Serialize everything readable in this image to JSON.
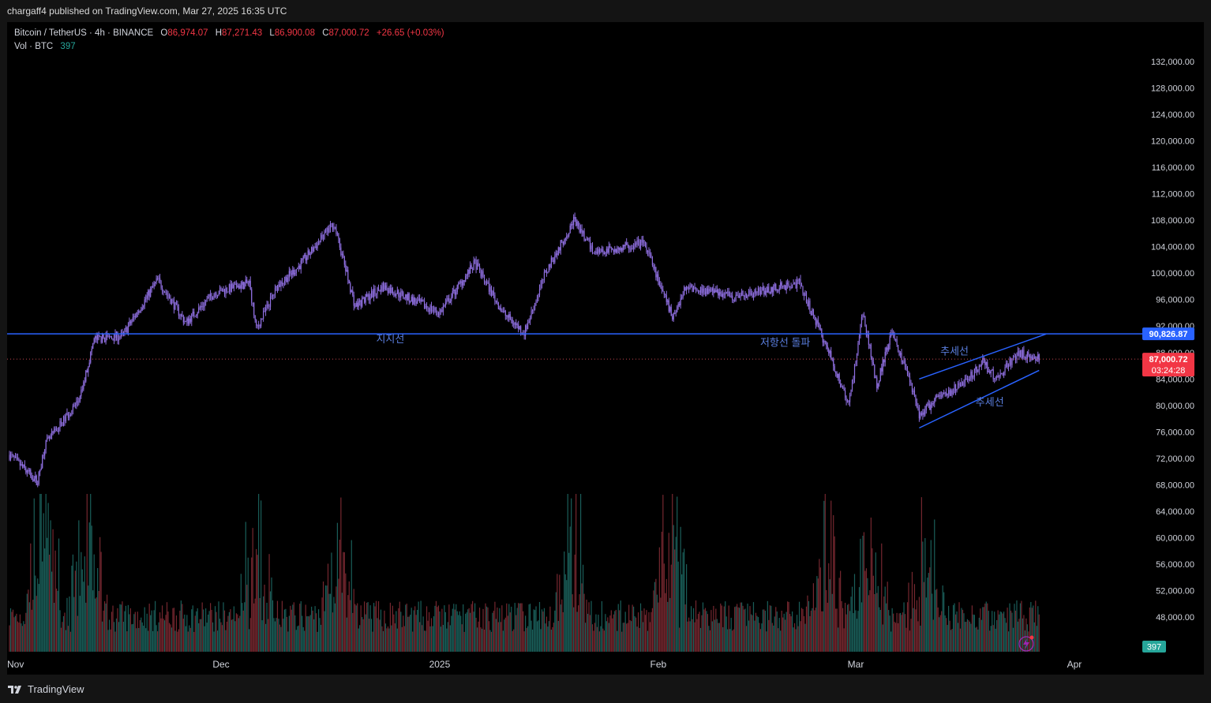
{
  "publish_line": "chargaff4 published on TradingView.com, Mar 27, 2025 16:35 UTC",
  "legend": {
    "symbol": "Bitcoin / TetherUS · 4h · BINANCE",
    "open_key": "O",
    "open": "86,974.07",
    "high_key": "H",
    "high": "87,271.43",
    "low_key": "L",
    "low": "86,900.08",
    "close_key": "C",
    "close": "87,000.72",
    "change": "+26.65 (+0.03%)",
    "vol_label": "Vol · BTC",
    "vol_value": "397"
  },
  "footer": {
    "brand": "TradingView"
  },
  "colors": {
    "up": "#26a69a",
    "down": "#f23645",
    "candle": "#8f6fe0",
    "line": "#2962ff",
    "annotation": "#5b7fe0",
    "background": "#000000"
  },
  "chart_data": {
    "type": "candlestick",
    "title": "",
    "x_ticks": [
      "Nov",
      "Dec",
      "2025",
      "Feb",
      "Mar",
      "Apr"
    ],
    "y_ticks": [
      "132,000.00",
      "128,000.00",
      "124,000.00",
      "120,000.00",
      "116,000.00",
      "112,000.00",
      "108,000.00",
      "104,000.00",
      "100,000.00",
      "96,000.00",
      "92,000.00",
      "88,000.00",
      "84,000.00",
      "80,000.00",
      "76,000.00",
      "72,000.00",
      "68,000.00",
      "64,000.00",
      "60,000.00",
      "56,000.00",
      "52,000.00",
      "48,000.00"
    ],
    "ylim": [
      46000,
      134000
    ],
    "price_path": [
      {
        "date": "2024-11-01",
        "price": 72500
      },
      {
        "date": "2024-11-05",
        "price": 68500
      },
      {
        "date": "2024-11-06",
        "price": 74000
      },
      {
        "date": "2024-11-11",
        "price": 81000
      },
      {
        "date": "2024-11-13",
        "price": 90000
      },
      {
        "date": "2024-11-17",
        "price": 90500
      },
      {
        "date": "2024-11-22",
        "price": 99000
      },
      {
        "date": "2024-11-26",
        "price": 92500
      },
      {
        "date": "2024-11-30",
        "price": 97000
      },
      {
        "date": "2024-12-05",
        "price": 98500
      },
      {
        "date": "2024-12-06",
        "price": 91500
      },
      {
        "date": "2024-12-09",
        "price": 98000
      },
      {
        "date": "2024-12-12",
        "price": 101000
      },
      {
        "date": "2024-12-17",
        "price": 107500
      },
      {
        "date": "2024-12-20",
        "price": 95000
      },
      {
        "date": "2024-12-24",
        "price": 98000
      },
      {
        "date": "2025-01-01",
        "price": 94000
      },
      {
        "date": "2025-01-06",
        "price": 101500
      },
      {
        "date": "2025-01-10",
        "price": 94000
      },
      {
        "date": "2025-01-13",
        "price": 91000
      },
      {
        "date": "2025-01-16",
        "price": 100000
      },
      {
        "date": "2025-01-20",
        "price": 108000
      },
      {
        "date": "2025-01-23",
        "price": 103000
      },
      {
        "date": "2025-01-30",
        "price": 104500
      },
      {
        "date": "2025-02-03",
        "price": 93500
      },
      {
        "date": "2025-02-05",
        "price": 98000
      },
      {
        "date": "2025-02-12",
        "price": 96500
      },
      {
        "date": "2025-02-21",
        "price": 98500
      },
      {
        "date": "2025-02-25",
        "price": 88500
      },
      {
        "date": "2025-02-28",
        "price": 80000
      },
      {
        "date": "2025-03-02",
        "price": 94000
      },
      {
        "date": "2025-03-04",
        "price": 83000
      },
      {
        "date": "2025-03-06",
        "price": 91000
      },
      {
        "date": "2025-03-08",
        "price": 86000
      },
      {
        "date": "2025-03-10",
        "price": 78500
      },
      {
        "date": "2025-03-13",
        "price": 81500
      },
      {
        "date": "2025-03-16",
        "price": 83000
      },
      {
        "date": "2025-03-19",
        "price": 86500
      },
      {
        "date": "2025-03-21",
        "price": 84000
      },
      {
        "date": "2025-03-24",
        "price": 88000
      },
      {
        "date": "2025-03-27",
        "price": 87000
      }
    ],
    "volume_description": "Volume histogram along bottom, peaks around Nov 6, Dec 6, Feb 3 and Mar 3",
    "horizontal_line": {
      "price": 90826.87,
      "label": "90,826.87"
    },
    "current_price": {
      "label": "87,000.72",
      "countdown": "03:24:28"
    },
    "volume_badge": "397",
    "annotations": [
      {
        "text": "지지선",
        "date": "2024-12-25",
        "price": 89500
      },
      {
        "text": "저항선 돌파",
        "date": "2025-02-19",
        "price": 89000
      },
      {
        "text": "추세선",
        "date": "2025-03-15",
        "price": 87700
      },
      {
        "text": "추세선",
        "date": "2025-03-20",
        "price": 80000
      }
    ],
    "trendlines": [
      {
        "from": {
          "date": "2025-03-10",
          "price": 84000
        },
        "to": {
          "date": "2025-03-28",
          "price": 90800
        }
      },
      {
        "from": {
          "date": "2025-03-10",
          "price": 76600
        },
        "to": {
          "date": "2025-03-27",
          "price": 85300
        }
      }
    ]
  }
}
